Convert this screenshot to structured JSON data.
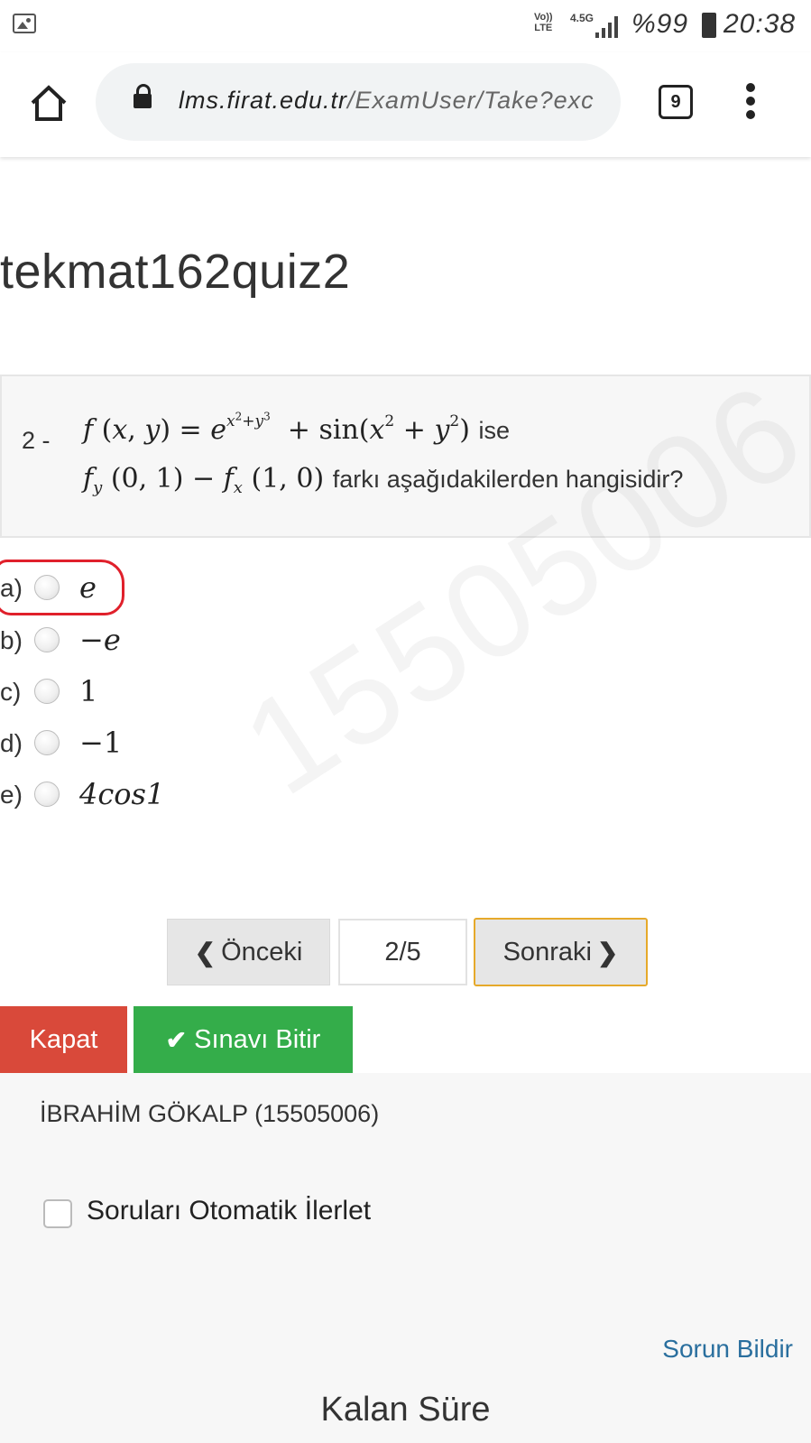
{
  "status_bar": {
    "network_top": "Vo))",
    "network_bottom": "LTE",
    "network_type": "4.5G",
    "battery": "%99",
    "time": "20:38"
  },
  "browser": {
    "url_host": "lms.firat.edu.tr",
    "url_path": "/ExamUser/Take?exc",
    "tab_count": "9"
  },
  "exam": {
    "title": "tekmat162quiz2",
    "question_number": "2 -",
    "question_suffix_1": "ise",
    "question_suffix_2": "farkı aşağıdakilerden hangisidir?",
    "watermark": "15505006"
  },
  "options": [
    {
      "label": "a)",
      "value": "e"
    },
    {
      "label": "b)",
      "value": "−e"
    },
    {
      "label": "c)",
      "value": "1"
    },
    {
      "label": "d)",
      "value": "−1"
    },
    {
      "label": "e)",
      "value": "4cos1"
    }
  ],
  "navigation": {
    "prev_label": "Önceki",
    "page": "2/5",
    "next_label": "Sonraki"
  },
  "actions": {
    "close_label": "Kapat",
    "finish_label": "Sınavı Bitir"
  },
  "footer": {
    "student": "İBRAHİM GÖKALP (15505006)",
    "auto_advance_label": "Soruları Otomatik İlerlet",
    "report_label": "Sorun Bildir",
    "remaining_label": "Kalan Süre"
  },
  "colors": {
    "close_button": "#d9493a",
    "finish_button": "#34ad4a",
    "next_border": "#e6a92a",
    "annotation_circle": "#e0202b",
    "link": "#2a6f9e"
  }
}
